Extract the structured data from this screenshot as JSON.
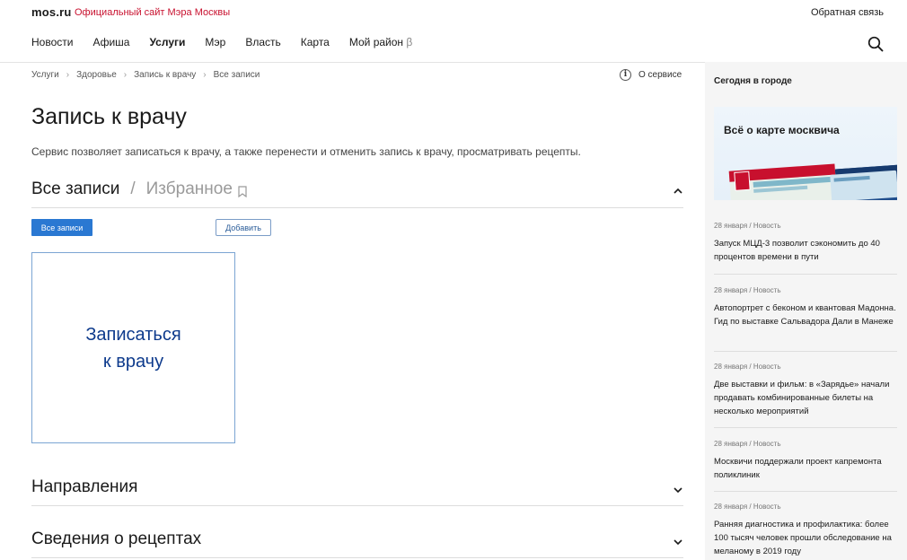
{
  "header": {
    "logo": "mos.ru",
    "site_desc": "Официальный сайт Мэра Москвы",
    "feedback": "Обратная связь"
  },
  "nav": {
    "items": [
      {
        "label": "Новости",
        "active": false
      },
      {
        "label": "Афиша",
        "active": false
      },
      {
        "label": "Услуги",
        "active": true
      },
      {
        "label": "Мэр",
        "active": false
      },
      {
        "label": "Власть",
        "active": false
      },
      {
        "label": "Карта",
        "active": false
      },
      {
        "label": "Мой район",
        "active": false
      }
    ],
    "beta_mark": "β"
  },
  "breadcrumb": [
    "Услуги",
    "Здоровье",
    "Запись к врачу",
    "Все записи"
  ],
  "about": {
    "icon_label": "i",
    "label": "О сервисе"
  },
  "page": {
    "title": "Запись к врачу",
    "description": "Сервис позволяет записаться к врачу, а также перенести и отменить запись к врачу, просматривать рецепты."
  },
  "records": {
    "tab_all": "Все записи",
    "separator": "/",
    "tab_favorites": "Избранное",
    "btn_all": "Все записи",
    "btn_add": "Добавить",
    "card_line1": "Записаться",
    "card_line2": "к врачу"
  },
  "sections": {
    "directions": "Направления",
    "prescriptions": "Сведения о рецептах"
  },
  "sidebar": {
    "title": "Сегодня в городе",
    "banner_text": "Всё о карте москвича",
    "news": [
      {
        "meta": "28 января / Новость",
        "headline": "Запуск МЦД-3 позволит сэкономить до 40 процентов времени в пути"
      },
      {
        "meta": "28 января / Новость",
        "headline": "Автопортрет с беконом и квантовая Мадонна. Гид по выставке Сальвадора Дали в Манеже"
      },
      {
        "meta": "28 января / Новость",
        "headline": "Две выставки и фильм: в «Зарядье» начали продавать комбинированные билеты на несколько мероприятий"
      },
      {
        "meta": "28 января / Новость",
        "headline": "Москвичи поддержали проект капремонта поликлиник"
      },
      {
        "meta": "28 января / Новость",
        "headline": "Ранняя диагностика и профилактика: более 100 тысяч человек прошли обследование на меланому в 2019 году"
      }
    ]
  },
  "colors": {
    "brand_red": "#c8102e",
    "primary_blue": "#2a78d2",
    "card_text_blue": "#0d3a8c"
  }
}
